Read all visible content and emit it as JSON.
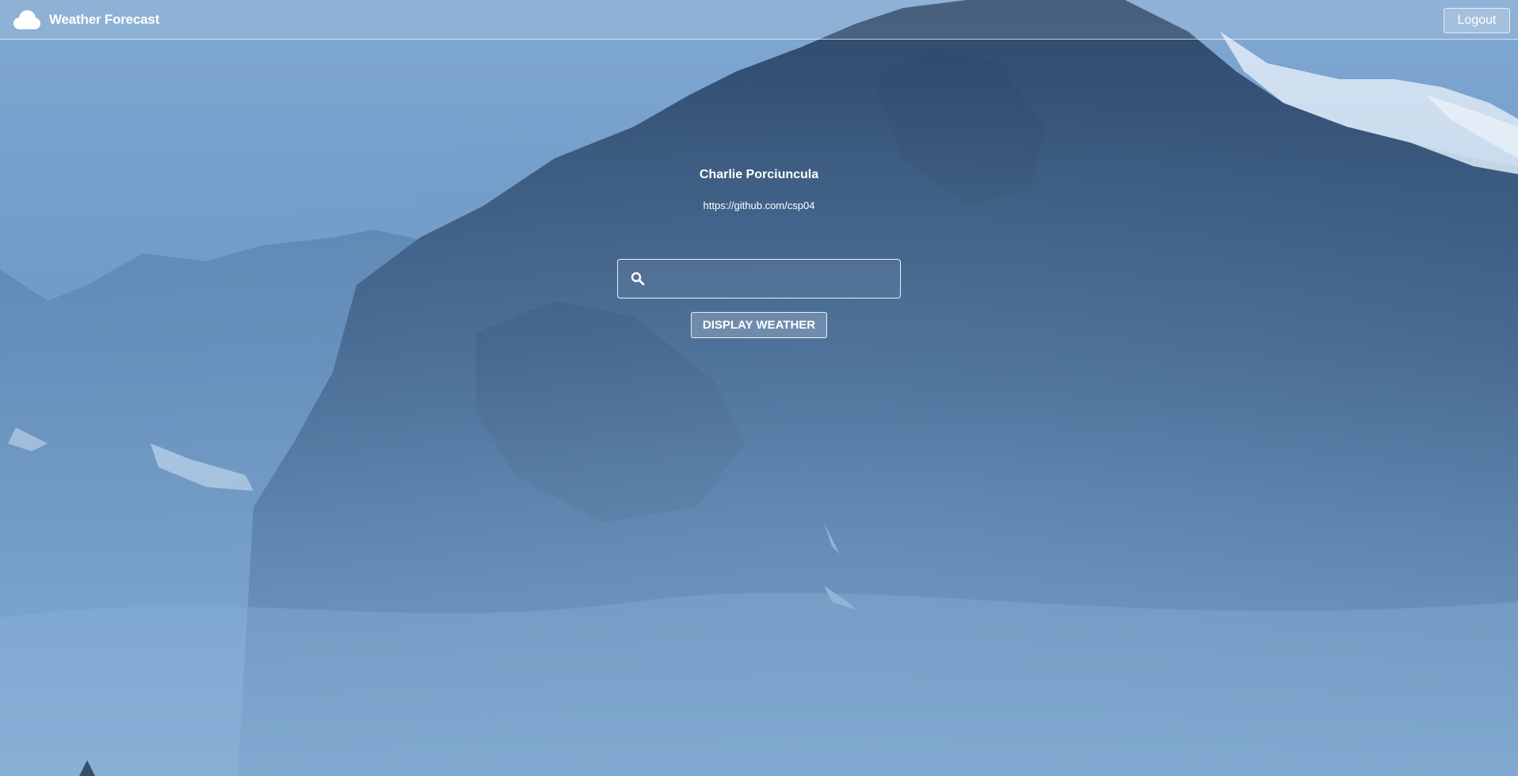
{
  "header": {
    "brand_icon": "cloud-icon",
    "title": "Weather Forecast",
    "logout_label": "Logout"
  },
  "profile": {
    "name": "Charlie Porciuncula",
    "link": "https://github.com/csp04"
  },
  "search": {
    "icon": "search-icon",
    "value": "",
    "placeholder": "",
    "button_label": "DISPLAY WEATHER"
  },
  "theme": {
    "sky": "#6f9ac8",
    "mountain": "#304c6e",
    "mist": "#7aa6cf",
    "snow": "#e6f1fb"
  }
}
